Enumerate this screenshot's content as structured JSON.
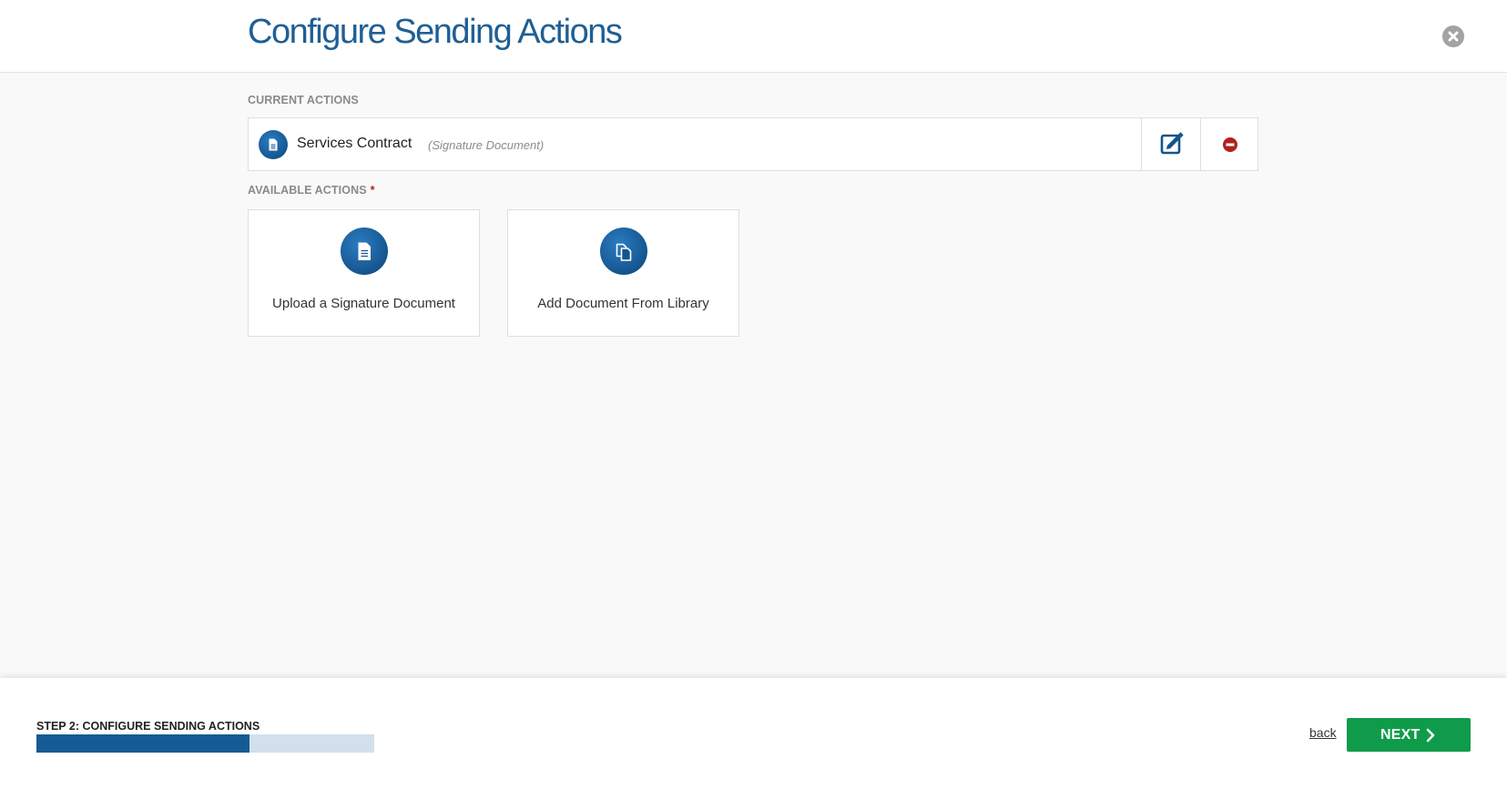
{
  "header": {
    "title": "Configure Sending Actions"
  },
  "current_actions": {
    "label": "CURRENT ACTIONS",
    "items": [
      {
        "name": "Services Contract",
        "type": "(Signature Document)"
      }
    ]
  },
  "available_actions": {
    "label": "AVAILABLE ACTIONS",
    "required_marker": "*",
    "cards": [
      {
        "label": "Upload a Signature Document",
        "icon": "document-icon"
      },
      {
        "label": "Add Document From Library",
        "icon": "library-copy-icon"
      }
    ]
  },
  "footer": {
    "step_label": "STEP 2: CONFIGURE SENDING ACTIONS",
    "progress_fraction": 0.63,
    "back_label": "back",
    "next_label": "NEXT"
  },
  "colors": {
    "title_blue": "#1f5f94",
    "icon_blue": "#14548c",
    "progress_fill": "#145c93",
    "progress_track": "#d1e0ec",
    "next_green": "#109b4b",
    "remove_red": "#b32020"
  }
}
